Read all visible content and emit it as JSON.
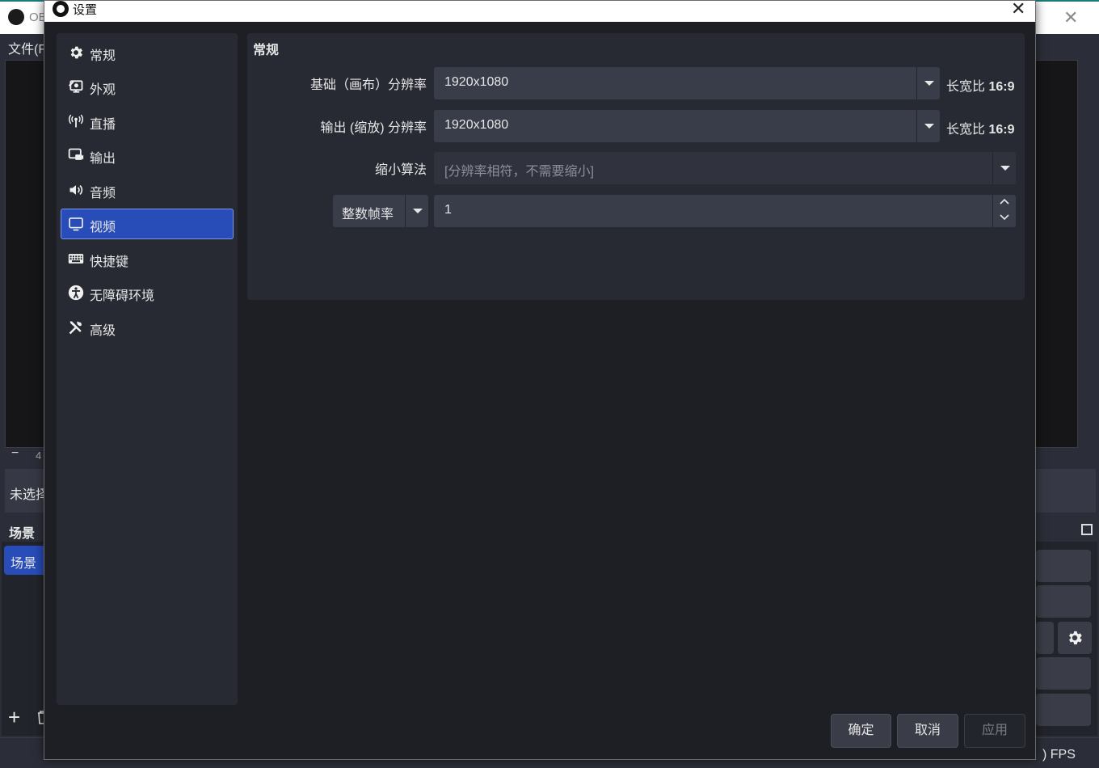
{
  "background": {
    "app_title": "OB",
    "menu_text": "文件(F",
    "zoom_minus": "−",
    "zoom_value": "4",
    "source_text": "未选择",
    "scenes_header": "场景",
    "scene_item": "场景",
    "add_icon": "plus-icon",
    "delete_icon": "trash-icon",
    "fps_text": ") FPS"
  },
  "dialog": {
    "title": "设置",
    "close_glyph": "✕"
  },
  "sidebar": {
    "items": [
      {
        "label": "常规",
        "icon": "gear-icon"
      },
      {
        "label": "外观",
        "icon": "appearance-icon"
      },
      {
        "label": "直播",
        "icon": "broadcast-icon"
      },
      {
        "label": "输出",
        "icon": "output-icon"
      },
      {
        "label": "音频",
        "icon": "speaker-icon"
      },
      {
        "label": "视频",
        "icon": "monitor-icon",
        "active": true
      },
      {
        "label": "快捷键",
        "icon": "keyboard-icon"
      },
      {
        "label": "无障碍环境",
        "icon": "accessibility-icon"
      },
      {
        "label": "高级",
        "icon": "tools-icon"
      }
    ]
  },
  "video": {
    "group_title": "常规",
    "base_resolution_label": "基础（画布）分辨率",
    "base_resolution_value": "1920x1080",
    "base_aspect_prefix": "长宽比",
    "base_aspect_value": "16:9",
    "output_resolution_label": "输出 (缩放) 分辨率",
    "output_resolution_value": "1920x1080",
    "output_aspect_prefix": "长宽比",
    "output_aspect_value": "16:9",
    "downscale_label": "缩小算法",
    "downscale_value": "[分辨率相符，不需要缩小]",
    "fps_type_value": "整数帧率",
    "fps_value": "1"
  },
  "buttons": {
    "ok": "确定",
    "cancel": "取消",
    "apply": "应用"
  }
}
